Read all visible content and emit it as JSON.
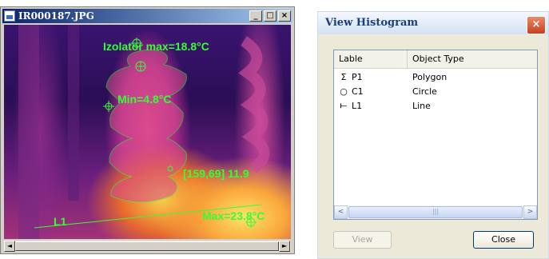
{
  "image_window": {
    "title": "IR000187.JPG",
    "buttons": {
      "minimize": "_",
      "maximize": "□",
      "close": "×"
    },
    "annotations": {
      "insulator_max": "Izolator max=18.8°C",
      "min": "Min=4.8°C",
      "coord": "[159,69] 11.9",
      "line_label": "L1",
      "max": "Max=23.8°C"
    },
    "scroll_left": "◄",
    "scroll_right": "►"
  },
  "dialog": {
    "title": "View Histogram",
    "close_glyph": "×",
    "columns": [
      "Lable",
      "Object Type"
    ],
    "rows": [
      {
        "icon": "Σ",
        "label": "P1",
        "type": "Polygon"
      },
      {
        "icon": "○",
        "label": "C1",
        "type": "Circle"
      },
      {
        "icon": "⟝",
        "label": "L1",
        "type": "Line"
      }
    ],
    "scroll_left": "<",
    "scroll_right": ">",
    "scroll_grip": "|||",
    "view_button": "View",
    "close_button": "Close"
  },
  "colors": {
    "annotation": "#33ff33",
    "titlebar_active": "#0a246a"
  }
}
